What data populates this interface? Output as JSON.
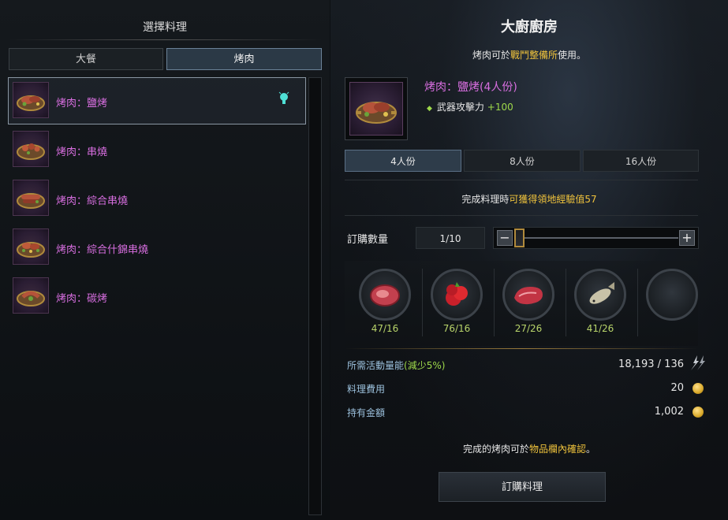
{
  "left": {
    "title": "選擇料理",
    "tabs": [
      {
        "label": "大餐"
      },
      {
        "label": "烤肉"
      }
    ],
    "recipes": [
      {
        "label": "烤肉：鹽烤"
      },
      {
        "label": "烤肉：串燒"
      },
      {
        "label": "烤肉：綜合串燒"
      },
      {
        "label": "烤肉：綜合什錦串燒"
      },
      {
        "label": "烤肉：碳烤"
      }
    ]
  },
  "right": {
    "title": "大廚廚房",
    "usage": {
      "prefix": "烤肉可於",
      "place": "戰鬥整備所",
      "suffix": "使用。"
    },
    "dish": {
      "name": "烤肉：鹽烤(4人份)",
      "effect_name": "武器攻擊力",
      "effect_value": "+100"
    },
    "sizes": [
      {
        "label": "4人份"
      },
      {
        "label": "8人份"
      },
      {
        "label": "16人份"
      }
    ],
    "exp": {
      "prefix": "完成料理時",
      "highlight": "可獲得領地經驗值57"
    },
    "quantity": {
      "label": "訂購數量",
      "value": "1/10",
      "minus": "−",
      "plus": "+",
      "fraction": 0.1
    },
    "ingredients": [
      {
        "count": "47/16",
        "icon": "raw-steak-icon"
      },
      {
        "count": "76/16",
        "icon": "red-fruit-icon"
      },
      {
        "count": "27/26",
        "icon": "meat-cut-icon"
      },
      {
        "count": "41/26",
        "icon": "fish-icon"
      }
    ],
    "stats": {
      "energy_label": "所需活動量能",
      "energy_discount": "(減少5%)",
      "energy_value": "18,193 / 136",
      "cost_label": "料理費用",
      "cost_value": "20",
      "gold_label": "持有金額",
      "gold_value": "1,002"
    },
    "confirm": {
      "prefix": "完成的烤肉可於",
      "highlight": "物品欄內確認",
      "suffix": "。"
    },
    "order_button": "訂購料理"
  },
  "colors": {
    "epic_purple": "#d86ee0",
    "highlight_yellow": "#f0c33c",
    "bonus_green": "#9ed94a",
    "stat_blue": "#9bc0dc"
  }
}
